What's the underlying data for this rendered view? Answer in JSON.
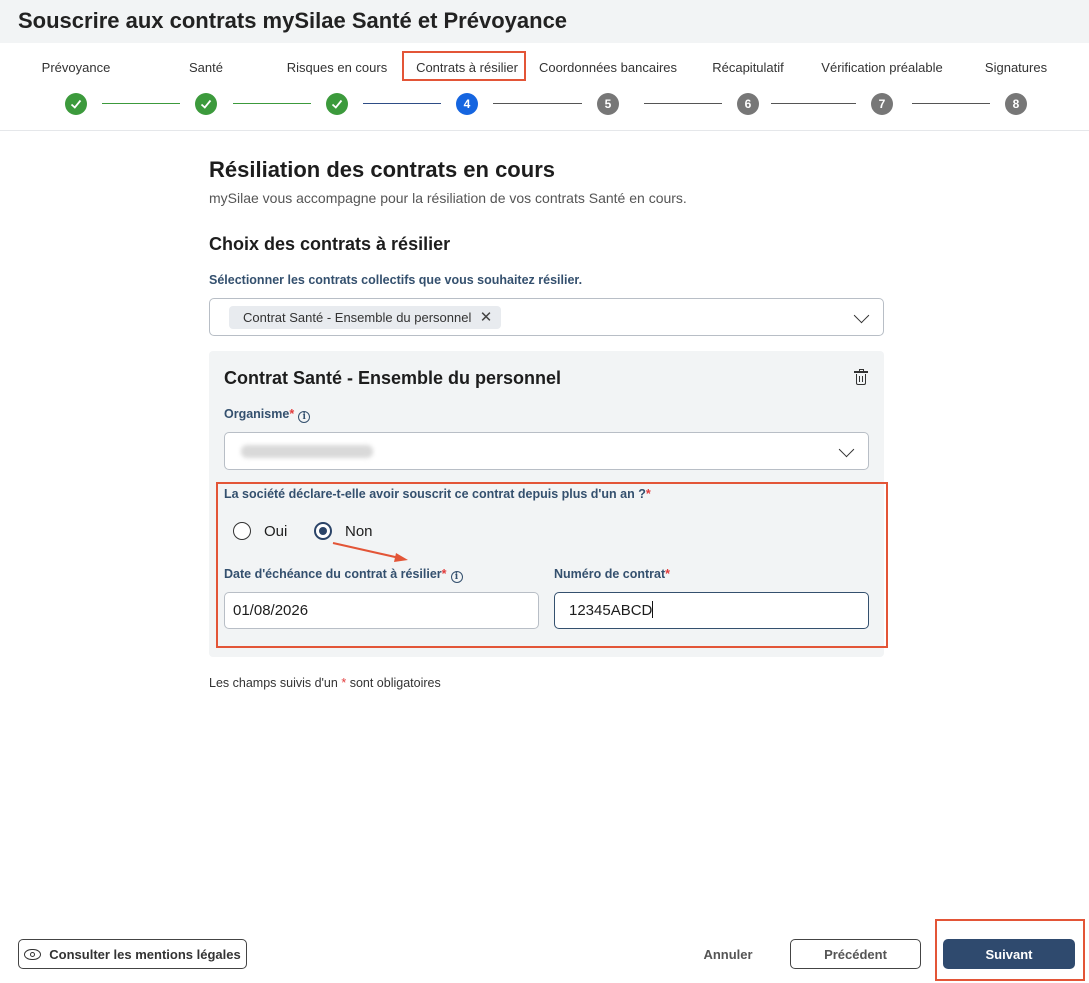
{
  "header": {
    "title": "Souscrire aux contrats mySilae Santé et Prévoyance"
  },
  "steps": [
    {
      "label": "Prévoyance",
      "number": "1",
      "status": "done"
    },
    {
      "label": "Santé",
      "number": "2",
      "status": "done"
    },
    {
      "label": "Risques en cours",
      "number": "3",
      "status": "done"
    },
    {
      "label": "Contrats à résilier",
      "number": "4",
      "status": "active"
    },
    {
      "label": "Coordonnées bancaires",
      "number": "5",
      "status": "todo"
    },
    {
      "label": "Récapitulatif",
      "number": "6",
      "status": "todo"
    },
    {
      "label": "Vérification préalable",
      "number": "7",
      "status": "todo"
    },
    {
      "label": "Signatures",
      "number": "8",
      "status": "todo"
    }
  ],
  "page": {
    "title": "Résiliation des contrats en cours",
    "subtitle": "mySilae vous accompagne pour la résiliation de vos contrats Santé en cours.",
    "section_title": "Choix des contrats à résilier",
    "select_label": "Sélectionner les contrats collectifs que vous souhaitez résilier.",
    "selected_chips": [
      "Contrat Santé - Ensemble du personnel"
    ]
  },
  "contract_card": {
    "title": "Contrat Santé - Ensemble du personnel",
    "organisme_label": "Organisme",
    "required_mark": "*",
    "question": "La société déclare-t-elle avoir souscrit ce contrat depuis plus d'un an ?",
    "radio_yes": "Oui",
    "radio_no": "Non",
    "selected_option": "Non",
    "date_label": "Date d'échéance du contrat à résilier",
    "date_value": "01/08/2026",
    "contract_number_label": "Numéro de contrat",
    "contract_number_value": "12345ABCD"
  },
  "footnote": {
    "before": "Les champs suivis d'un",
    "after": "sont obligatoires"
  },
  "footer": {
    "legal_button": "Consulter les mentions légales",
    "cancel_button": "Annuler",
    "previous_button": "Précédent",
    "next_button": "Suivant"
  },
  "colors": {
    "done": "#3c9a3c",
    "active": "#1565e0",
    "todo": "#777777",
    "primary": "#2f4a6e",
    "highlight": "#e35537",
    "required": "#e23b3b"
  },
  "icons": [
    "check-icon",
    "close-icon",
    "chevron-down-icon",
    "info-icon",
    "trash-icon",
    "eye-icon",
    "arrow-annotation"
  ]
}
